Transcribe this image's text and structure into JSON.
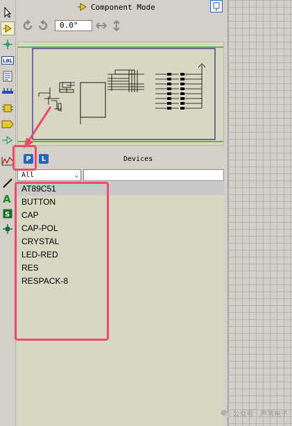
{
  "toolbar_icons": [
    "selection-icon",
    "component-icon",
    "junction-dot-icon",
    "wire-label-icon",
    "text-script-icon",
    "buses-icon",
    "subcircuit-icon",
    "terminals-icon",
    "device-pins-icon",
    "graph-icon",
    "line-icon",
    "text-icon",
    "symbol-icon",
    "marker-icon"
  ],
  "mode": {
    "title": "Component Mode"
  },
  "rotation": {
    "angle": "0.0°"
  },
  "pick_panel": {
    "p_label": "P",
    "l_label": "L",
    "title": "Devices"
  },
  "filter": {
    "selected": "All",
    "search_value": ""
  },
  "devices": [
    "AT89C51",
    "BUTTON",
    "CAP",
    "CAP-POL",
    "CRYSTAL",
    "LED-RED",
    "RES",
    "RESPACK-8"
  ],
  "selected_device_index": 0,
  "watermark": {
    "text": "公众号 · 芦苇电子"
  },
  "colors": {
    "annotation": "#ea4d67",
    "accent_blue": "#2764b7",
    "schematic_blue": "#1a2a8a",
    "schematic_green": "#10a020"
  }
}
